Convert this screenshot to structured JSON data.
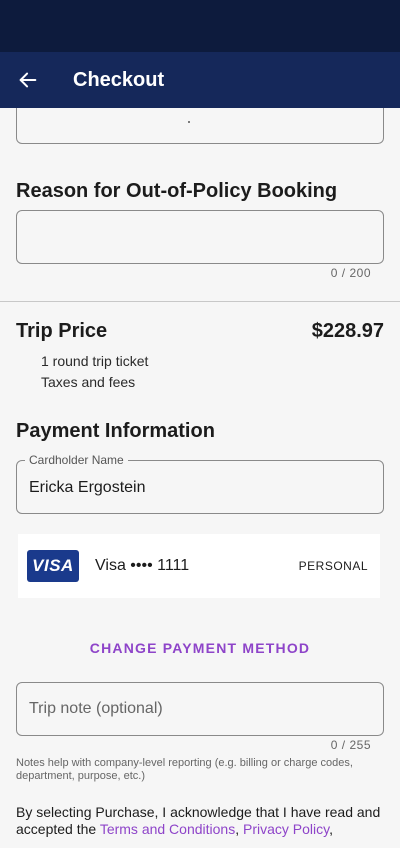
{
  "header": {
    "title": "Checkout"
  },
  "reason": {
    "heading": "Reason for Out-of-Policy Booking",
    "counter": "0 / 200"
  },
  "trip_price": {
    "heading": "Trip Price",
    "amount": "$228.97",
    "items": [
      "1 round trip ticket",
      "Taxes and fees"
    ]
  },
  "payment": {
    "heading": "Payment Information",
    "cardholder_label": "Cardholder Name",
    "cardholder_value": "Ericka Ergostein",
    "card_brand": "VISA",
    "card_label": "Visa •••• 1111",
    "card_type": "PERSONAL",
    "change_label": "CHANGE PAYMENT METHOD"
  },
  "trip_note": {
    "placeholder": "Trip note (optional)",
    "counter": "0 / 255",
    "hint": "Notes help with company-level reporting (e.g. billing or charge codes, department, purpose, etc.)"
  },
  "legal": {
    "text": "By selecting Purchase, I acknowledge that I have read and accepted the ",
    "terms_link": "Terms and Conditions",
    "separator": ", ",
    "privacy_link": "Privacy Policy",
    "trailing": ","
  },
  "colors": {
    "status_bar": "#0d1b3d",
    "app_bar": "#15285a",
    "accent": "#8e44c9",
    "visa": "#1a3a8c"
  }
}
